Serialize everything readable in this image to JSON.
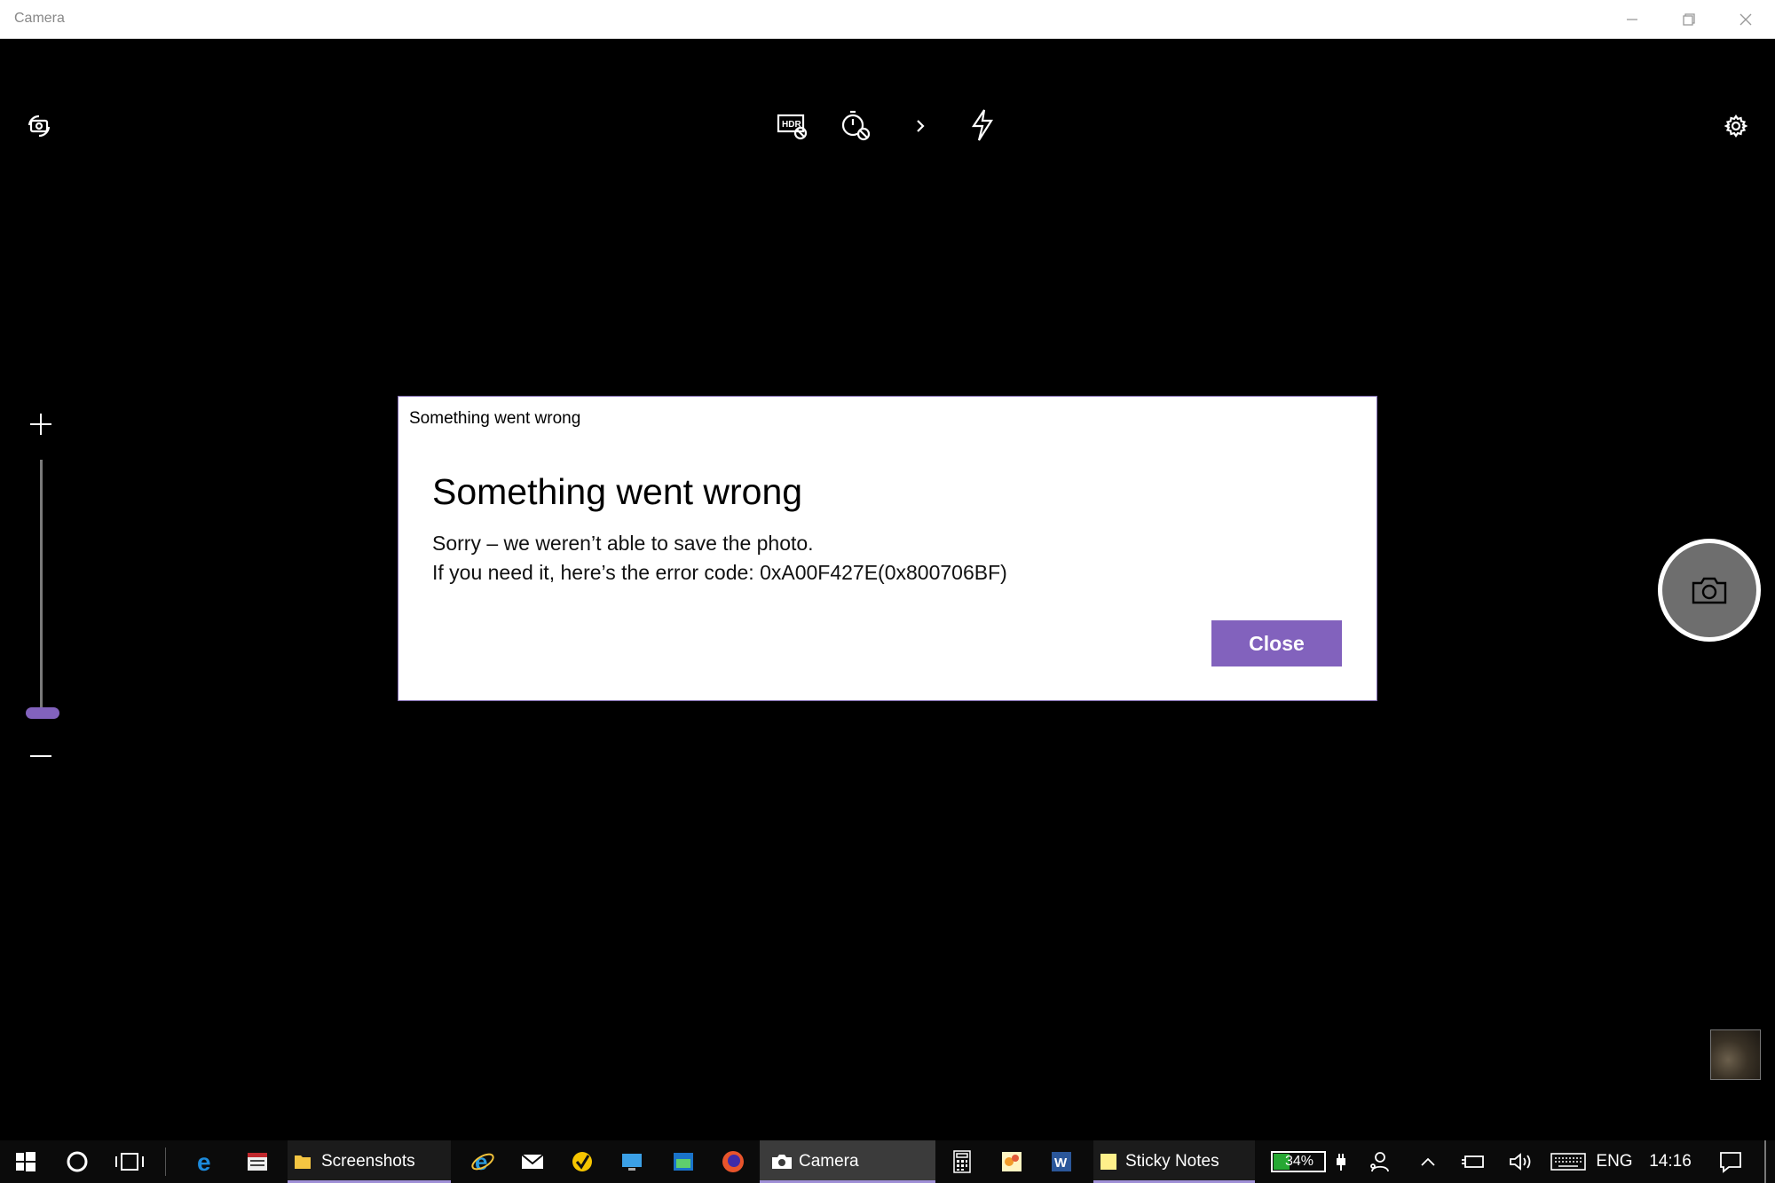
{
  "window": {
    "title": "Camera"
  },
  "accent": "#8262bd",
  "toolbar": {
    "left_icon": "camera-switch-icon",
    "center_icons": [
      "hdr-off-icon",
      "timer-off-icon",
      "chevron-right-icon",
      "flash-icon"
    ],
    "right_icon": "gear-icon"
  },
  "zoom": {
    "plus": "+",
    "minus": "—",
    "level": 0
  },
  "dialog": {
    "caption": "Something went wrong",
    "heading": "Something went wrong",
    "line1": "Sorry – we weren’t able to save the photo.",
    "line2": "If you need it, here’s the error code: 0xA00F427E(0x800706BF)",
    "close_label": "Close"
  },
  "taskbar": {
    "apps": [
      {
        "name": "Screenshots",
        "active": true
      },
      {
        "name": "Camera",
        "active": true,
        "selected": true
      },
      {
        "name": "Sticky Notes",
        "active": true
      }
    ],
    "tray": {
      "battery": "34%",
      "language": "ENG",
      "time": "14:16"
    }
  }
}
